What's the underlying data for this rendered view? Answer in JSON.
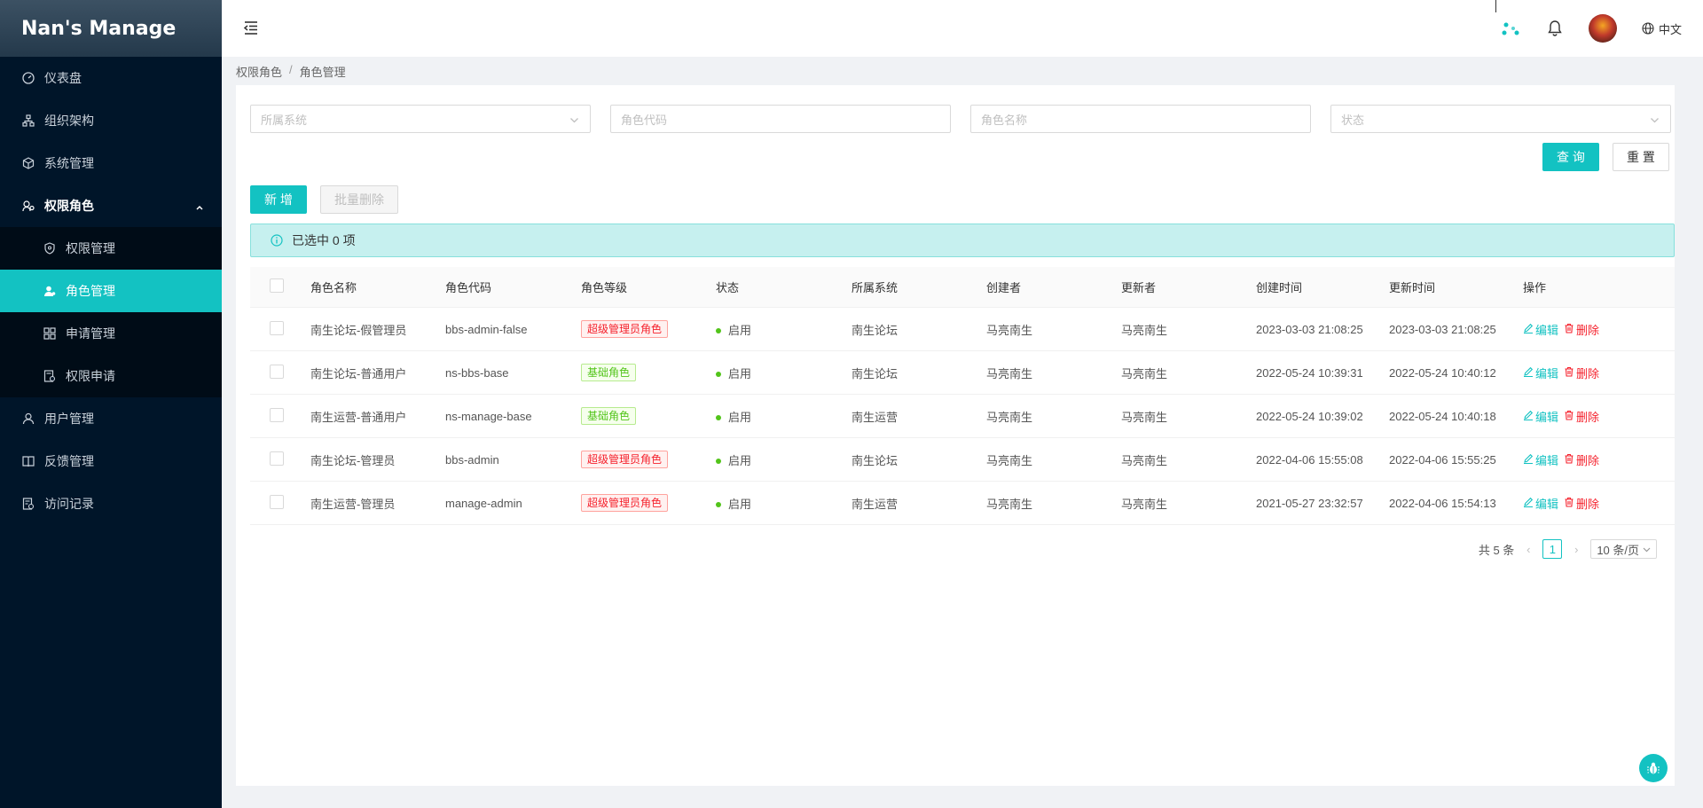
{
  "app": {
    "title": "Nan's Manage"
  },
  "sidebar": {
    "items": [
      {
        "label": "仪表盘",
        "icon": "dashboard-icon"
      },
      {
        "label": "组织架构",
        "icon": "org-icon"
      },
      {
        "label": "系统管理",
        "icon": "cube-icon"
      },
      {
        "label": "权限角色",
        "icon": "role-icon",
        "open": true
      },
      {
        "label": "用户管理",
        "icon": "user-icon"
      },
      {
        "label": "反馈管理",
        "icon": "book-icon"
      },
      {
        "label": "访问记录",
        "icon": "record-icon"
      }
    ],
    "submenu": [
      {
        "label": "权限管理",
        "icon": "shield-icon"
      },
      {
        "label": "角色管理",
        "icon": "user-role-icon",
        "active": true
      },
      {
        "label": "申请管理",
        "icon": "apply-icon"
      },
      {
        "label": "权限申请",
        "icon": "request-icon"
      }
    ]
  },
  "header": {
    "lang": "中文"
  },
  "breadcrumb": {
    "parent": "权限角色",
    "sep": "/",
    "current": "角色管理"
  },
  "filters": {
    "system_placeholder": "所属系统",
    "code_placeholder": "角色代码",
    "name_placeholder": "角色名称",
    "status_placeholder": "状态"
  },
  "toolbar": {
    "query_label": "查 询",
    "reset_label": "重 置",
    "add_label": "新 增",
    "batch_delete_label": "批量删除"
  },
  "alert": {
    "text": "已选中 0 项"
  },
  "table": {
    "headers": [
      "角色名称",
      "角色代码",
      "角色等级",
      "状态",
      "所属系统",
      "创建者",
      "更新者",
      "创建时间",
      "更新时间",
      "操作"
    ],
    "rows": [
      {
        "name": "南生论坛-假管理员",
        "code": "bbs-admin-false",
        "level": "超级管理员角色",
        "level_type": "red",
        "status": "启用",
        "system": "南生论坛",
        "creator": "马亮南生",
        "updater": "马亮南生",
        "created": "2023-03-03 21:08:25",
        "updated": "2023-03-03 21:08:25"
      },
      {
        "name": "南生论坛-普通用户",
        "code": "ns-bbs-base",
        "level": "基础角色",
        "level_type": "green",
        "status": "启用",
        "system": "南生论坛",
        "creator": "马亮南生",
        "updater": "马亮南生",
        "created": "2022-05-24 10:39:31",
        "updated": "2022-05-24 10:40:12"
      },
      {
        "name": "南生运营-普通用户",
        "code": "ns-manage-base",
        "level": "基础角色",
        "level_type": "green",
        "status": "启用",
        "system": "南生运营",
        "creator": "马亮南生",
        "updater": "马亮南生",
        "created": "2022-05-24 10:39:02",
        "updated": "2022-05-24 10:40:18"
      },
      {
        "name": "南生论坛-管理员",
        "code": "bbs-admin",
        "level": "超级管理员角色",
        "level_type": "red",
        "status": "启用",
        "system": "南生论坛",
        "creator": "马亮南生",
        "updater": "马亮南生",
        "created": "2022-04-06 15:55:08",
        "updated": "2022-04-06 15:55:25"
      },
      {
        "name": "南生运营-管理员",
        "code": "manage-admin",
        "level": "超级管理员角色",
        "level_type": "red",
        "status": "启用",
        "system": "南生运营",
        "creator": "马亮南生",
        "updater": "马亮南生",
        "created": "2021-05-27 23:32:57",
        "updated": "2022-04-06 15:54:13"
      }
    ],
    "edit_label": "编辑",
    "delete_label": "删除"
  },
  "pagination": {
    "total_label": "共 5 条",
    "current_page": "1",
    "page_size": "10 条/页"
  },
  "colors": {
    "accent": "#13c2c2",
    "sidebar_bg": "#001529",
    "danger": "#f5222d",
    "success": "#52c41a"
  }
}
